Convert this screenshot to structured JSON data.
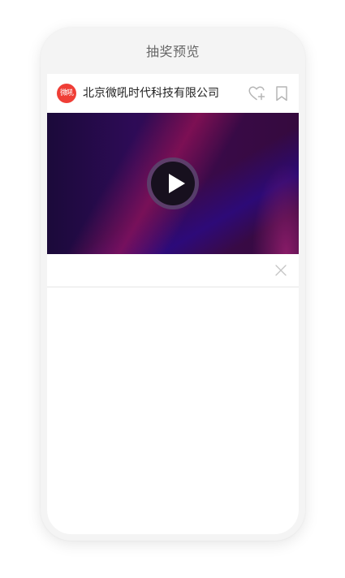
{
  "page": {
    "title": "抽奖预览"
  },
  "header": {
    "avatar_text": "微吼",
    "company_name": "北京微吼时代科技有限公司",
    "avatar_color": "#ef3e36"
  },
  "icons": {
    "like": "heart-plus-icon",
    "bookmark": "bookmark-icon",
    "play": "play-icon",
    "close": "close-icon"
  },
  "video": {
    "colors": [
      "#1b0a3a",
      "#2e0b57",
      "#3a0a4a",
      "#b4145a"
    ]
  }
}
